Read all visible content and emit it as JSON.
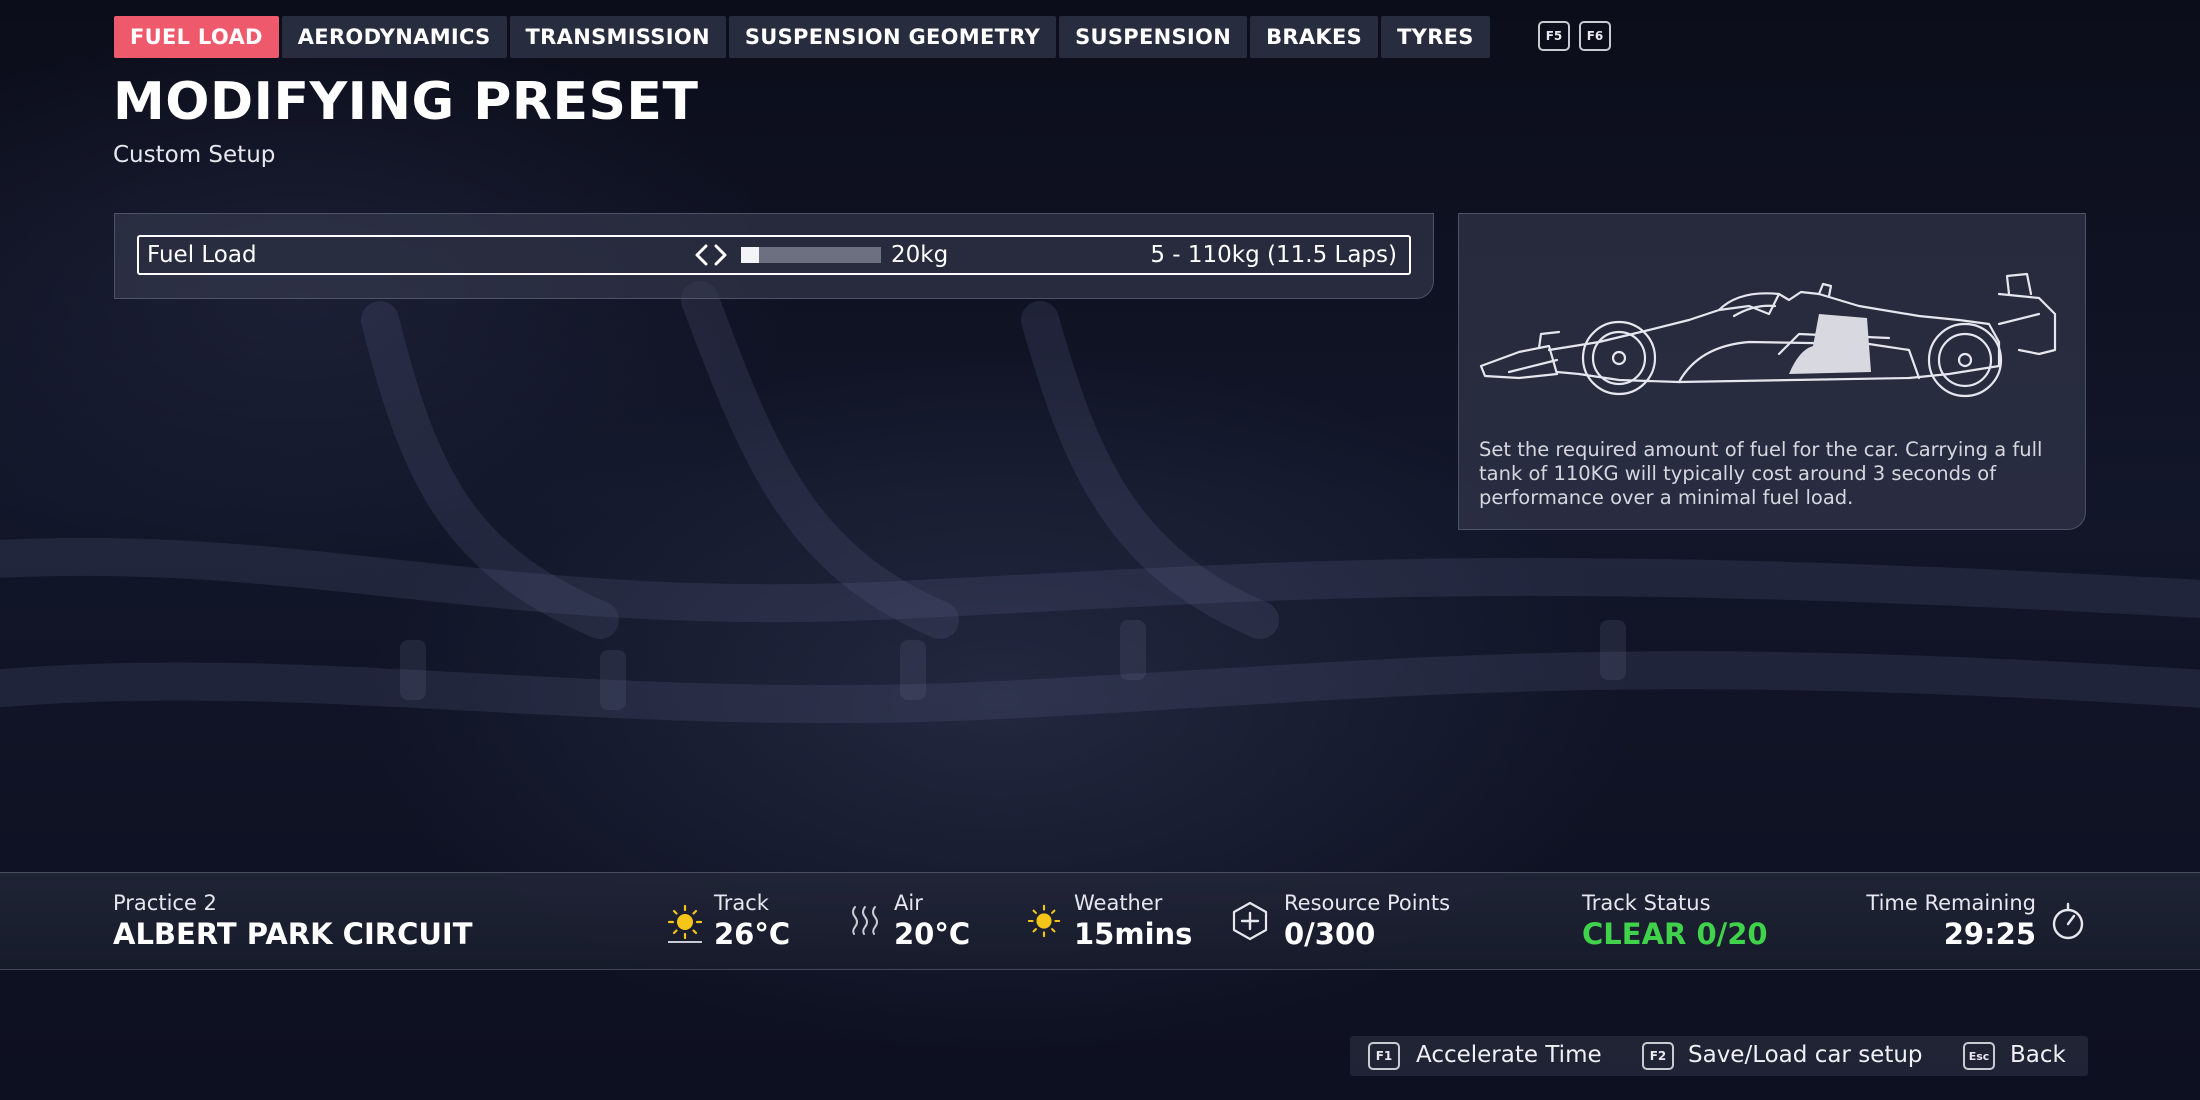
{
  "tabs": [
    {
      "label": "FUEL LOAD",
      "active": true
    },
    {
      "label": "AERODYNAMICS",
      "active": false
    },
    {
      "label": "TRANSMISSION",
      "active": false
    },
    {
      "label": "SUSPENSION GEOMETRY",
      "active": false
    },
    {
      "label": "SUSPENSION",
      "active": false
    },
    {
      "label": "BRAKES",
      "active": false
    },
    {
      "label": "TYRES",
      "active": false
    }
  ],
  "tab_keys": {
    "prev": "F5",
    "next": "F6"
  },
  "header": {
    "title": "MODIFYING PRESET",
    "subtitle": "Custom Setup"
  },
  "setup": {
    "fuel_load": {
      "label": "Fuel Load",
      "value": "20kg",
      "range": "5 - 110kg (11.5 Laps)",
      "slider_fraction": 0.13
    }
  },
  "info": {
    "description": "Set the required amount of fuel for the car. Carrying a full tank of 110KG will typically cost around 3 seconds of performance over a minimal fuel load.",
    "image_icon": "f1-car-side-outline-icon"
  },
  "status": {
    "session": "Practice 2",
    "circuit": "ALBERT PARK CIRCUIT",
    "track_label": "Track",
    "track_temp": "26°C",
    "air_label": "Air",
    "air_temp": "20°C",
    "weather_label": "Weather",
    "weather_value": "15mins",
    "resource_label": "Resource Points",
    "resource_value": "0/300",
    "track_status_label": "Track Status",
    "track_status_value": "CLEAR 0/20",
    "time_label": "Time Remaining",
    "time_value": "29:25"
  },
  "footer": {
    "accelerate": {
      "key": "F1",
      "label": "Accelerate Time"
    },
    "save_load": {
      "key": "F2",
      "label": "Save/Load car setup"
    },
    "back": {
      "key": "Esc",
      "label": "Back"
    }
  },
  "colors": {
    "active_tab": "#ee5a6b",
    "track_clear": "#3fd24a",
    "sun": "#f5c518"
  }
}
